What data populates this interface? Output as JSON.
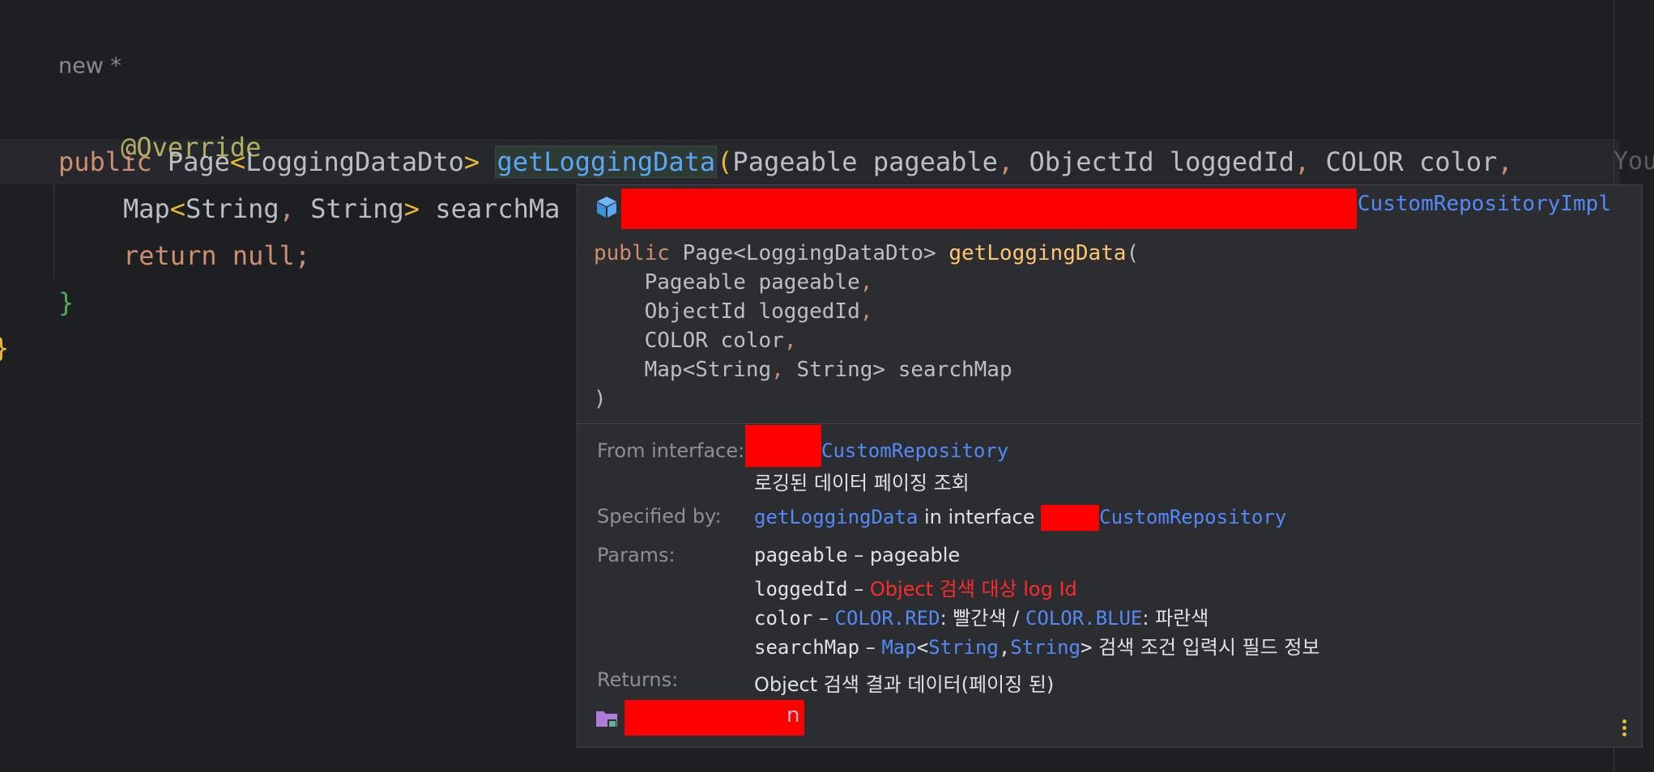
{
  "editor": {
    "hint": "new *",
    "line_annotation": "@Override",
    "line1": {
      "kw": "public",
      "type": "Page",
      "lt": "<",
      "type_arg": "LoggingDataDto",
      "gt": ">",
      "method": "getLoggingData",
      "paren": "(",
      "p1": "Pageable pageable",
      "c1": ",",
      "p2": "ObjectId loggedId",
      "c2": ",",
      "p3": "COLOR color",
      "c3": ","
    },
    "inlay_author": "You",
    "line2": {
      "map": "Map",
      "lt": "<",
      "s1": "String",
      "comma": ",",
      "s2": "String",
      "gt": ">",
      "rest": "searchMa"
    },
    "line3": {
      "kw": "return",
      "val": "null;"
    },
    "close_brace": "}",
    "outer_brace": "}"
  },
  "popup": {
    "class_name": "CustomRepositoryImpl",
    "signature": {
      "kw": "public",
      "ret": "Page<LoggingDataDto>",
      "method": "getLoggingData",
      "open": "(",
      "p1": "Pageable pageable",
      "p2": "ObjectId loggedId",
      "p3": "COLOR color",
      "p4_a": "Map<String",
      "p4_b": "String> searchMap",
      "close": ")"
    },
    "from_interface_label": "From interface:",
    "from_interface_value": "CustomRepository",
    "description": "로깅된 데이터 페이징 조회",
    "specified_by_label": "Specified by:",
    "specified_by_method": "getLoggingData",
    "specified_by_mid": "in interface",
    "specified_by_interface": "CustomRepository",
    "params_label": "Params:",
    "params": {
      "p1_name": "pageable",
      "p1_desc": "pageable",
      "p2_name": "loggedId",
      "p2_desc": "Object 검색 대상 log Id",
      "p3_name": "color",
      "p3_red": "COLOR.RED",
      "p3_red_desc": ": 빨간색 /",
      "p3_blue": "COLOR.BLUE",
      "p3_blue_desc": ": 파란색",
      "p4_name": "searchMap",
      "p4_map": "Map",
      "p4_lt": "<",
      "p4_string1": "String",
      "p4_comma": ",",
      "p4_string2": "String",
      "p4_gt": ">",
      "p4_desc": "검색 조건 입력시 필드 정보"
    },
    "dash": "–",
    "returns_label": "Returns:",
    "returns_value": "Object 검색 결과 데이터(페이징 된)",
    "footer_suffix": "n"
  },
  "colors": {
    "background": "#1e1f22",
    "popup_bg": "#2b2d30",
    "link": "#548af7",
    "keyword": "#cf8e6d",
    "method": "#56a8f5",
    "redaction": "#ff0000"
  },
  "icons": [
    "cube-icon",
    "folder-icon",
    "more-vertical-icon"
  ]
}
